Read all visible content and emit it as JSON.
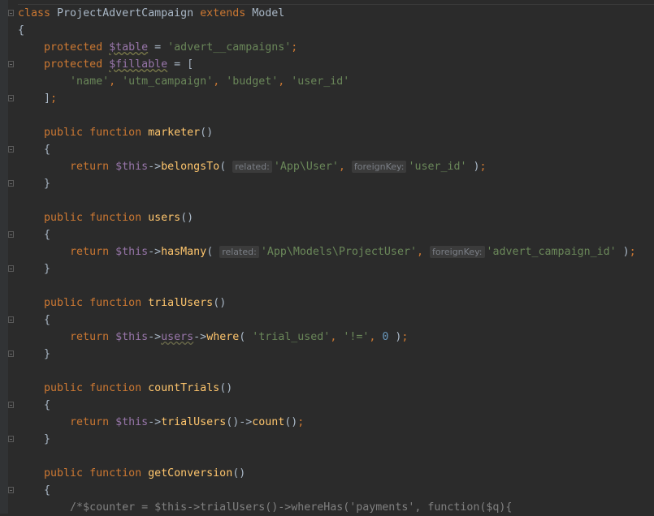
{
  "editor": {
    "colors": {
      "kw": "#cc7832",
      "var": "#9876aa",
      "str": "#6a8759",
      "fn": "#ffc66d",
      "txt": "#a9b7c6",
      "num": "#6897bb",
      "comment": "#808080"
    },
    "lines": [
      {
        "fold": true,
        "t": [
          [
            "kw",
            "class "
          ],
          [
            "txt",
            "ProjectAdvertCampaign "
          ],
          [
            "kw",
            "extends "
          ],
          [
            "txt",
            "Model"
          ]
        ]
      },
      {
        "t": [
          [
            "txt",
            "{"
          ]
        ]
      },
      {
        "t": [
          [
            "txt",
            "    "
          ],
          [
            "kw",
            "protected "
          ],
          [
            "uvar",
            "$table"
          ],
          [
            "txt",
            " = "
          ],
          [
            "str",
            "'advert__campaigns'"
          ],
          [
            "kw",
            ";"
          ]
        ]
      },
      {
        "fold": true,
        "t": [
          [
            "txt",
            "    "
          ],
          [
            "kw",
            "protected "
          ],
          [
            "uvar",
            "$fillable"
          ],
          [
            "txt",
            " = ["
          ]
        ]
      },
      {
        "t": [
          [
            "txt",
            "        "
          ],
          [
            "str",
            "'name'"
          ],
          [
            "kw",
            ", "
          ],
          [
            "str",
            "'utm_campaign'"
          ],
          [
            "kw",
            ", "
          ],
          [
            "str",
            "'budget'"
          ],
          [
            "kw",
            ", "
          ],
          [
            "str",
            "'user_id'"
          ]
        ]
      },
      {
        "fold": true,
        "t": [
          [
            "txt",
            "    ]"
          ],
          [
            "kw",
            ";"
          ]
        ]
      },
      {
        "t": []
      },
      {
        "t": [
          [
            "txt",
            "    "
          ],
          [
            "kw",
            "public function "
          ],
          [
            "fn",
            "marketer"
          ],
          [
            "txt",
            "()"
          ]
        ]
      },
      {
        "fold": true,
        "t": [
          [
            "txt",
            "    {"
          ]
        ]
      },
      {
        "t": [
          [
            "txt",
            "        "
          ],
          [
            "kw",
            "return "
          ],
          [
            "var",
            "$this"
          ],
          [
            "txt",
            "->"
          ],
          [
            "fn",
            "belongsTo"
          ],
          [
            "txt",
            "( "
          ],
          [
            "hint",
            "related:"
          ],
          [
            "str",
            "'App\\User'"
          ],
          [
            "kw",
            ", "
          ],
          [
            "hint",
            "foreignKey:"
          ],
          [
            "str",
            "'user_id'"
          ],
          [
            "txt",
            " )"
          ],
          [
            "kw",
            ";"
          ]
        ]
      },
      {
        "fold": true,
        "t": [
          [
            "txt",
            "    }"
          ]
        ]
      },
      {
        "t": []
      },
      {
        "t": [
          [
            "txt",
            "    "
          ],
          [
            "kw",
            "public function "
          ],
          [
            "fn",
            "users"
          ],
          [
            "txt",
            "()"
          ]
        ]
      },
      {
        "fold": true,
        "t": [
          [
            "txt",
            "    {"
          ]
        ]
      },
      {
        "t": [
          [
            "txt",
            "        "
          ],
          [
            "kw",
            "return "
          ],
          [
            "var",
            "$this"
          ],
          [
            "txt",
            "->"
          ],
          [
            "fn",
            "hasMany"
          ],
          [
            "txt",
            "( "
          ],
          [
            "hint",
            "related:"
          ],
          [
            "str",
            "'App\\Models\\ProjectUser'"
          ],
          [
            "kw",
            ", "
          ],
          [
            "hint",
            "foreignKey:"
          ],
          [
            "str",
            "'advert_campaign_id'"
          ],
          [
            "txt",
            " )"
          ],
          [
            "kw",
            ";"
          ]
        ]
      },
      {
        "fold": true,
        "t": [
          [
            "txt",
            "    }"
          ]
        ]
      },
      {
        "t": []
      },
      {
        "t": [
          [
            "txt",
            "    "
          ],
          [
            "kw",
            "public function "
          ],
          [
            "fn",
            "trialUsers"
          ],
          [
            "txt",
            "()"
          ]
        ]
      },
      {
        "fold": true,
        "t": [
          [
            "txt",
            "    {"
          ]
        ]
      },
      {
        "t": [
          [
            "txt",
            "        "
          ],
          [
            "kw",
            "return "
          ],
          [
            "var",
            "$this"
          ],
          [
            "txt",
            "->"
          ],
          [
            "prop",
            "users"
          ],
          [
            "txt",
            "->"
          ],
          [
            "fn",
            "where"
          ],
          [
            "txt",
            "( "
          ],
          [
            "str",
            "'trial_used'"
          ],
          [
            "kw",
            ", "
          ],
          [
            "str",
            "'!='"
          ],
          [
            "kw",
            ", "
          ],
          [
            "num",
            "0"
          ],
          [
            "txt",
            " )"
          ],
          [
            "kw",
            ";"
          ]
        ]
      },
      {
        "fold": true,
        "t": [
          [
            "txt",
            "    }"
          ]
        ]
      },
      {
        "t": []
      },
      {
        "t": [
          [
            "txt",
            "    "
          ],
          [
            "kw",
            "public function "
          ],
          [
            "fn",
            "countTrials"
          ],
          [
            "txt",
            "()"
          ]
        ]
      },
      {
        "fold": true,
        "t": [
          [
            "txt",
            "    {"
          ]
        ]
      },
      {
        "t": [
          [
            "txt",
            "        "
          ],
          [
            "kw",
            "return "
          ],
          [
            "var",
            "$this"
          ],
          [
            "txt",
            "->"
          ],
          [
            "fn",
            "trialUsers"
          ],
          [
            "txt",
            "()->"
          ],
          [
            "fn",
            "count"
          ],
          [
            "txt",
            "()"
          ],
          [
            "kw",
            ";"
          ]
        ]
      },
      {
        "fold": true,
        "t": [
          [
            "txt",
            "    }"
          ]
        ]
      },
      {
        "t": []
      },
      {
        "t": [
          [
            "txt",
            "    "
          ],
          [
            "kw",
            "public function "
          ],
          [
            "fn",
            "getConversion"
          ],
          [
            "txt",
            "()"
          ]
        ]
      },
      {
        "fold": true,
        "t": [
          [
            "txt",
            "    {"
          ]
        ]
      },
      {
        "t": [
          [
            "txt",
            "        "
          ],
          [
            "cm",
            "/*$counter = $this->trialUsers()->whereHas('payments', function($q){"
          ]
        ]
      }
    ]
  }
}
